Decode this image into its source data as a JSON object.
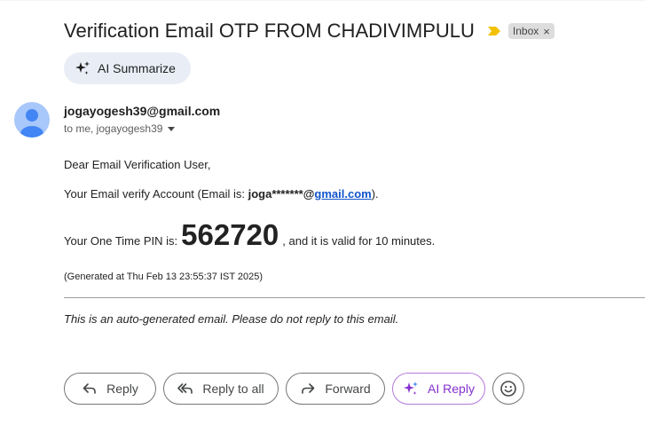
{
  "email": {
    "subject": "Verification Email OTP FROM CHADIVIMPULU",
    "label": "Inbox",
    "label_close": "×",
    "summarize_label": "AI Summarize",
    "sender": "jogayogesh39@gmail.com",
    "recipients": "to me, jogayogesh39",
    "body": {
      "greeting": "Dear Email Verification User,",
      "verify_prefix": "Your Email verify Account (Email is: ",
      "masked_user": "joga*******@",
      "masked_domain": "gmail.com",
      "verify_suffix": ").",
      "pin_prefix": "Your One Time PIN is: ",
      "pin": "562720",
      "pin_suffix": ", and it is valid for 10 minutes.",
      "generated": "(Generated at Thu Feb 13 23:55:37 IST 2025)",
      "footer": "This is an auto-generated email. Please do not reply to this email."
    }
  },
  "actions": {
    "reply": "Reply",
    "reply_all": "Reply to all",
    "forward": "Forward",
    "ai_reply": "AI Reply"
  },
  "colors": {
    "importance_marker": "#f2c200",
    "avatar_bg": "#a8c7fa",
    "avatar_fg": "#4285f4",
    "ai_accent": "#8430ce",
    "link": "#1155cc"
  }
}
